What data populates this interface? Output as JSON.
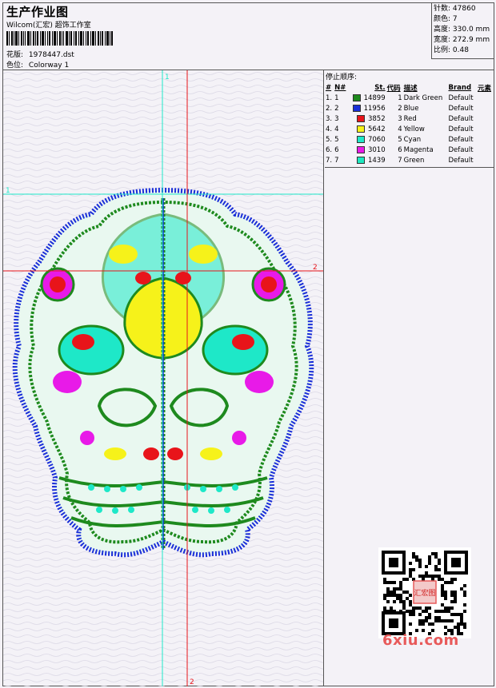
{
  "header": {
    "title": "生产作业图",
    "subtitle": "Wilcom(汇宏) 超饰工作室",
    "design_label": "花版:",
    "design_value": "1978447.dst",
    "colorway_label": "色位:",
    "colorway_value": "Colorway 1"
  },
  "stats": [
    {
      "label": "针数:",
      "value": "47860"
    },
    {
      "label": "颜色:",
      "value": "7"
    },
    {
      "label": "高度:",
      "value": "330.0 mm"
    },
    {
      "label": "宽度:",
      "value": "272.9 mm"
    },
    {
      "label": "比例:",
      "value": "0.48"
    }
  ],
  "stop_sequence": {
    "title": "停止顺序:",
    "columns": [
      "#",
      "N#",
      "St.",
      "代码",
      "描述",
      "Brand",
      "元素"
    ],
    "rows": [
      {
        "idx": "1.",
        "n": "1",
        "color": "#1e8a1e",
        "st": "14899",
        "code": "1",
        "desc": "Dark Green",
        "brand": "Default"
      },
      {
        "idx": "2.",
        "n": "2",
        "color": "#1a2fd8",
        "st": "11956",
        "code": "2",
        "desc": "Blue",
        "brand": "Default"
      },
      {
        "idx": "3.",
        "n": "3",
        "color": "#e8141a",
        "st": "3852",
        "code": "3",
        "desc": "Red",
        "brand": "Default"
      },
      {
        "idx": "4.",
        "n": "4",
        "color": "#f6f21a",
        "st": "5642",
        "code": "4",
        "desc": "Yellow",
        "brand": "Default"
      },
      {
        "idx": "5.",
        "n": "5",
        "color": "#1ee8c8",
        "st": "7060",
        "code": "5",
        "desc": "Cyan",
        "brand": "Default"
      },
      {
        "idx": "6.",
        "n": "6",
        "color": "#e81ae8",
        "st": "3010",
        "code": "6",
        "desc": "Magenta",
        "brand": "Default"
      },
      {
        "idx": "7.",
        "n": "7",
        "color": "#1ee8c0",
        "st": "1439",
        "code": "7",
        "desc": "Green",
        "brand": "Default"
      }
    ]
  },
  "guides": {
    "v1_label": "1",
    "h1_label": "1",
    "h2_label": "2",
    "v2_label": "2"
  },
  "watermark": "6xiu.com",
  "qr_seal_text": "汇宏图"
}
